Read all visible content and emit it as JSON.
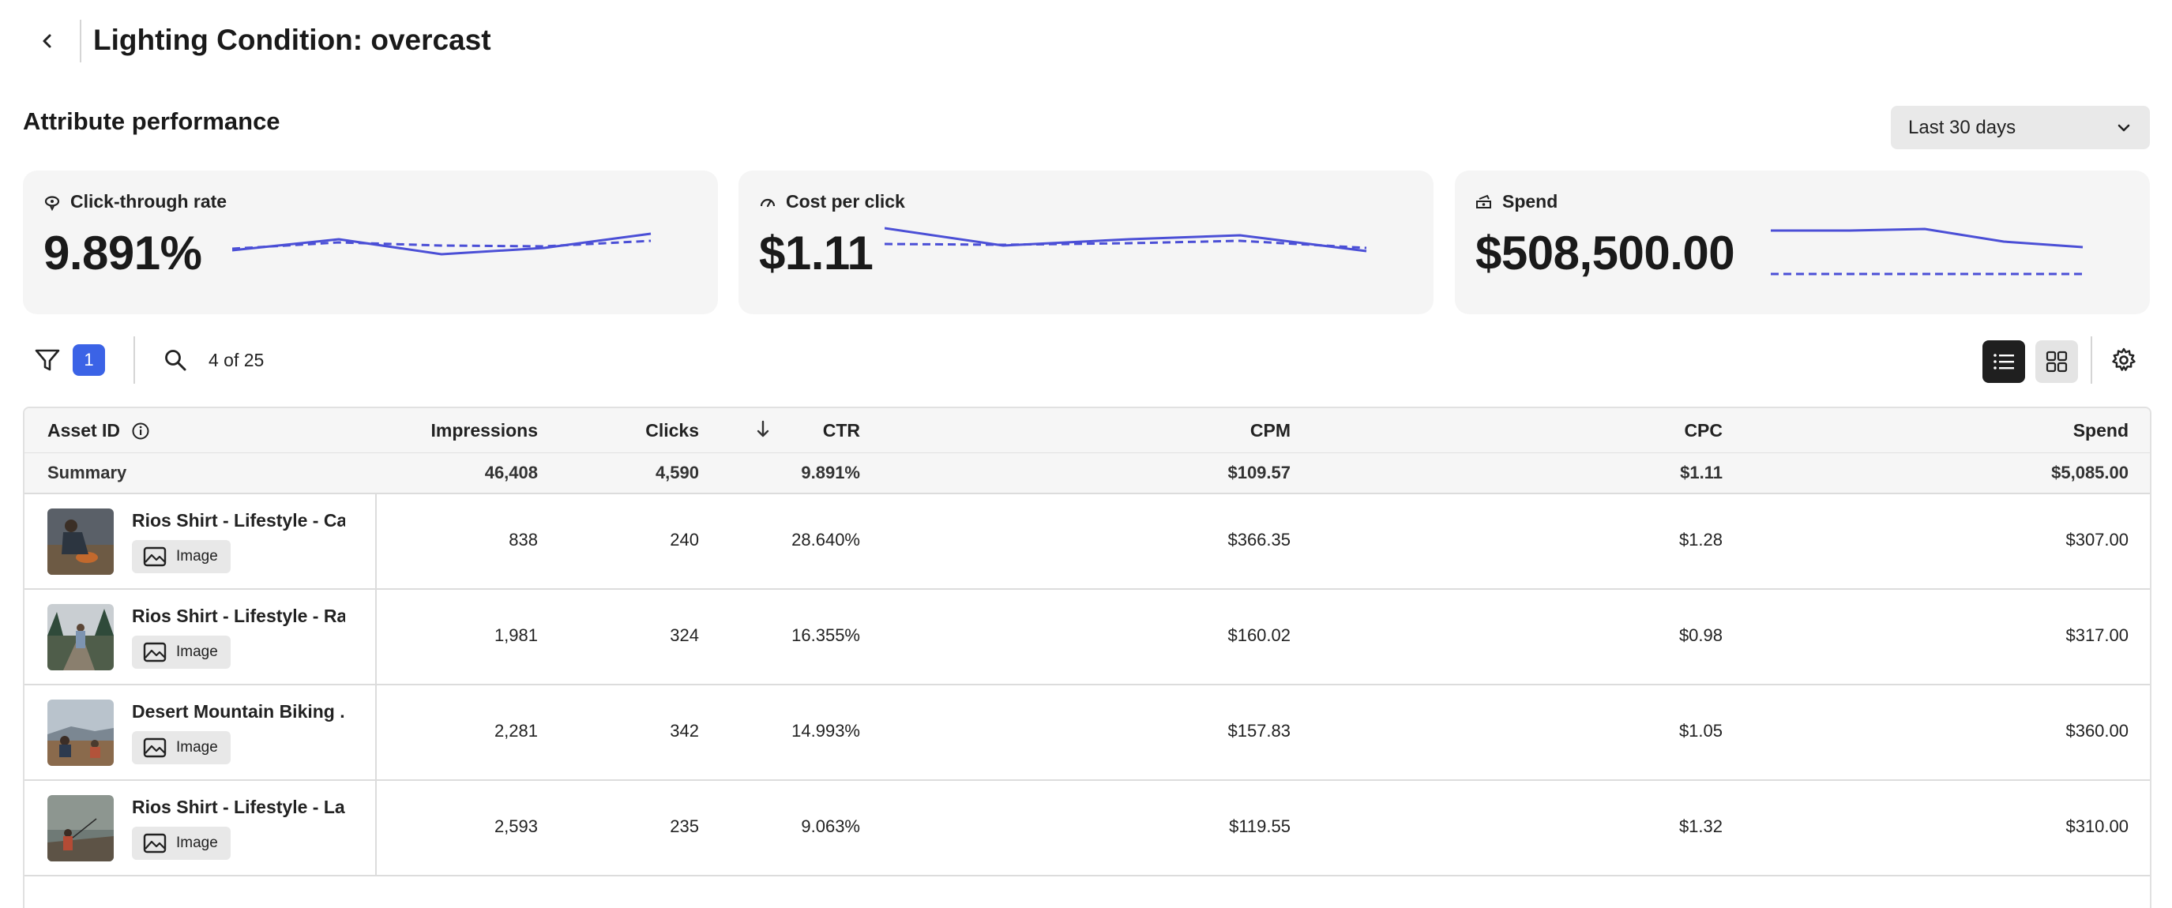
{
  "header": {
    "title": "Lighting Condition: overcast"
  },
  "section": {
    "title": "Attribute performance",
    "date_range": "Last 30 days"
  },
  "kpis": [
    {
      "label": "Click-through rate",
      "value": "9.891%"
    },
    {
      "label": "Cost per click",
      "value": "$1.11"
    },
    {
      "label": "Spend",
      "value": "$508,500.00"
    }
  ],
  "toolbar": {
    "filter_count": "1",
    "result_count": "4 of 25"
  },
  "table": {
    "columns": {
      "asset_id": "Asset ID",
      "impressions": "Impressions",
      "clicks": "Clicks",
      "ctr": "CTR",
      "cpm": "CPM",
      "cpc": "CPC",
      "spend": "Spend"
    },
    "summary": {
      "label": "Summary",
      "impressions": "46,408",
      "clicks": "4,590",
      "ctr": "9.891%",
      "cpm": "$109.57",
      "cpc": "$1.11",
      "spend": "$5,085.00"
    },
    "rows": [
      {
        "name": "Rios Shirt - Lifestyle - Ca...",
        "type": "Image",
        "impressions": "838",
        "clicks": "240",
        "ctr": "28.640%",
        "cpm": "$366.35",
        "cpc": "$1.28",
        "spend": "$307.00"
      },
      {
        "name": "Rios Shirt - Lifestyle - Ra...",
        "type": "Image",
        "impressions": "1,981",
        "clicks": "324",
        "ctr": "16.355%",
        "cpm": "$160.02",
        "cpc": "$0.98",
        "spend": "$317.00"
      },
      {
        "name": "Desert Mountain Biking ...",
        "type": "Image",
        "impressions": "2,281",
        "clicks": "342",
        "ctr": "14.993%",
        "cpm": "$157.83",
        "cpc": "$1.05",
        "spend": "$360.00"
      },
      {
        "name": "Rios Shirt - Lifestyle - La...",
        "type": "Image",
        "impressions": "2,593",
        "clicks": "235",
        "ctr": "9.063%",
        "cpm": "$119.55",
        "cpc": "$1.32",
        "spend": "$310.00"
      }
    ]
  },
  "icons": {
    "back": "chevron-left-icon",
    "dropdown": "chevron-down-icon",
    "filter": "funnel-icon",
    "search": "magnifier-icon",
    "list_view": "list-view-icon",
    "grid_view": "grid-view-icon",
    "settings": "gear-icon",
    "info": "info-icon",
    "sort": "arrow-down-icon",
    "image": "image-icon"
  },
  "colors": {
    "accent": "#3b63e6",
    "sparkline": "#4b4fd6"
  }
}
